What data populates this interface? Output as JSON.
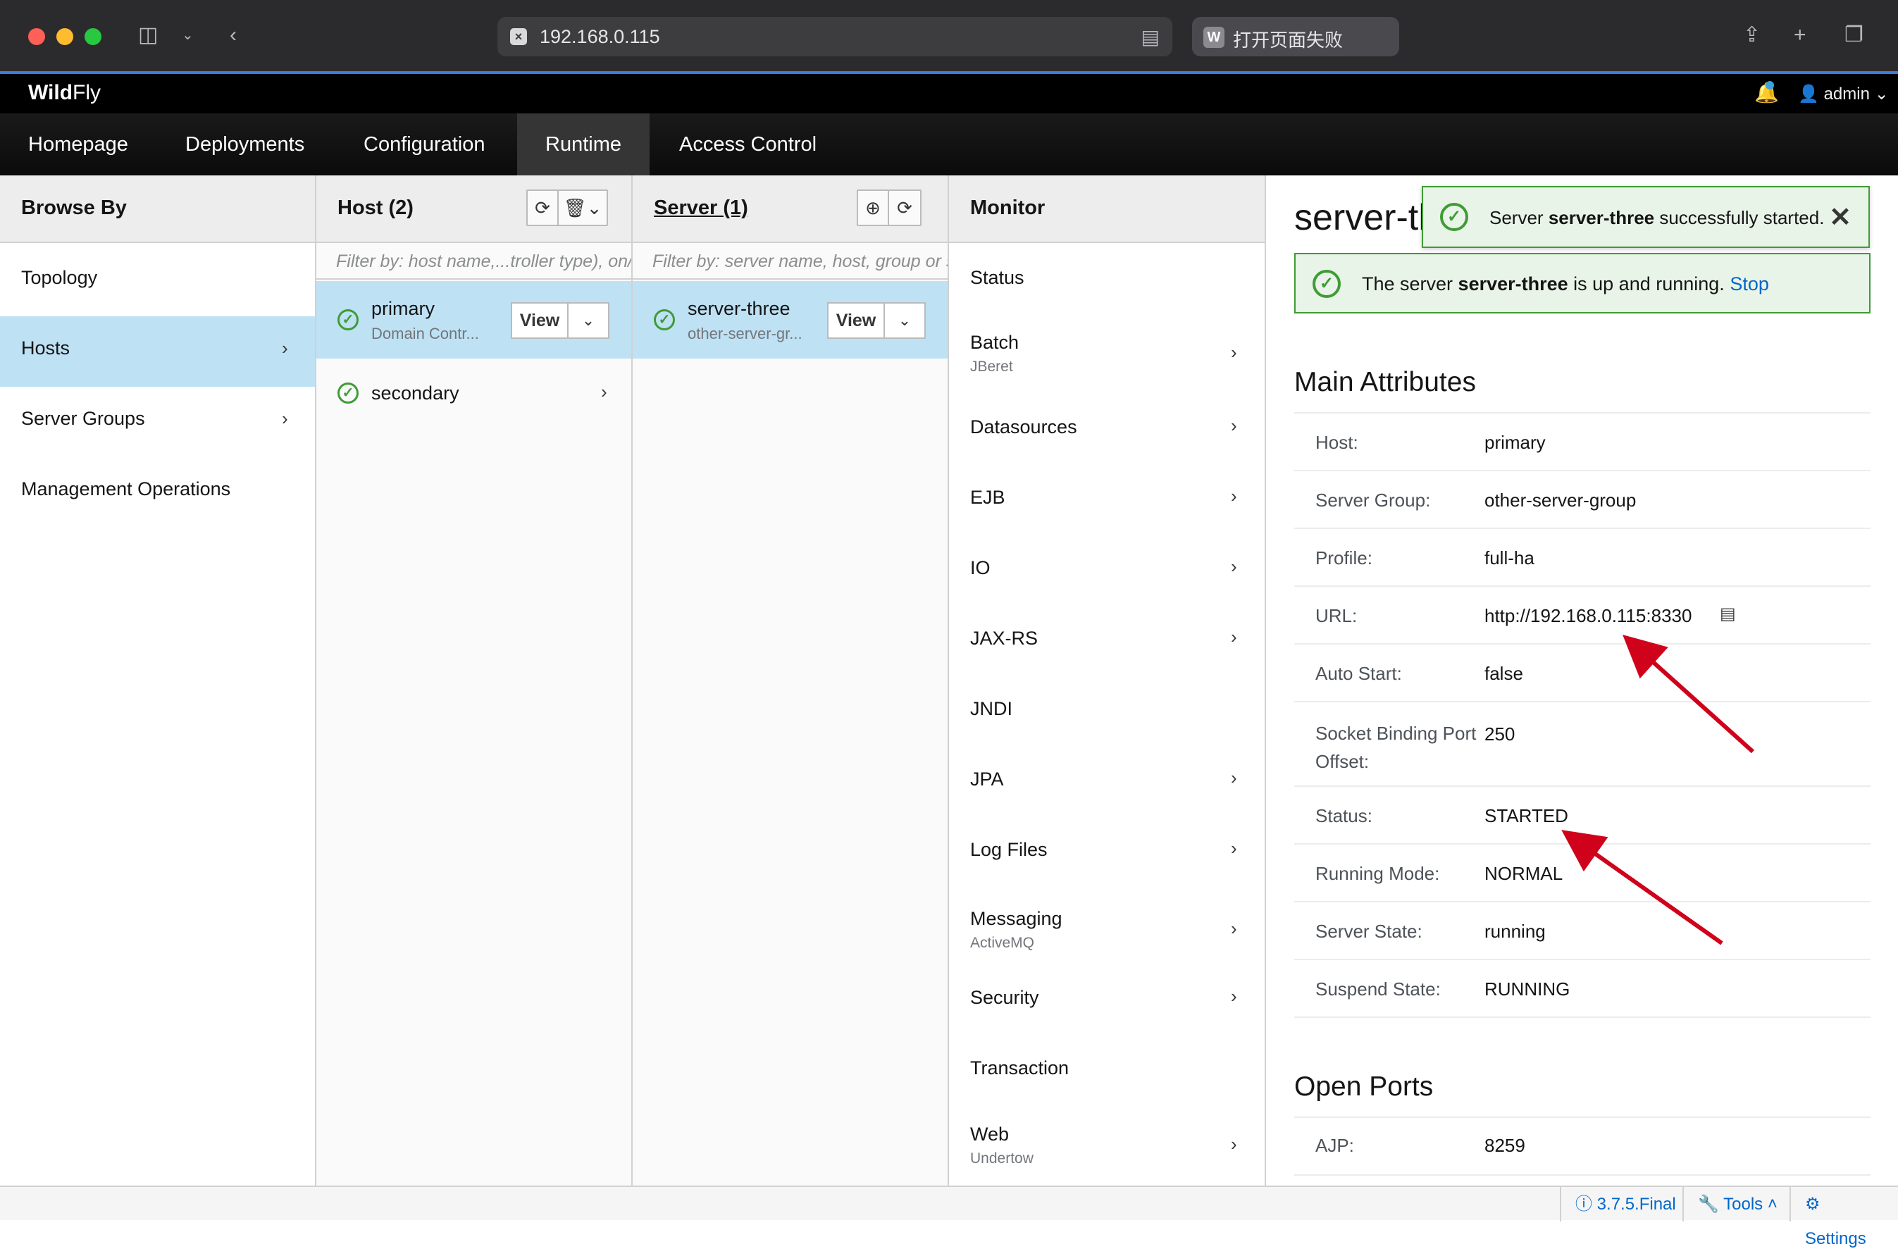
{
  "browser": {
    "url": "192.168.0.115",
    "site_icon": "x-icon",
    "tab_icon_letter": "W",
    "tab_title": "打开页面失败"
  },
  "app": {
    "brand_bold": "Wild",
    "brand_rest": "Fly",
    "user": "admin"
  },
  "nav": {
    "items": [
      "Homepage",
      "Deployments",
      "Configuration",
      "Runtime",
      "Access Control"
    ],
    "active": "Runtime"
  },
  "browse_by": {
    "title": "Browse By",
    "items": [
      "Topology",
      "Hosts",
      "Server Groups",
      "Management Operations"
    ],
    "selected": "Hosts"
  },
  "hosts": {
    "title": "Host (2)",
    "filter_placeholder": "Filter by: host name,...troller type), on/off",
    "items": [
      {
        "name": "primary",
        "subtitle": "Domain Contr...",
        "view_label": "View"
      },
      {
        "name": "secondary"
      }
    ]
  },
  "servers": {
    "title": "Server (1)",
    "filter_placeholder": "Filter by: server name, host, group or status",
    "items": [
      {
        "name": "server-three",
        "subtitle": "other-server-gr...",
        "view_label": "View"
      }
    ]
  },
  "monitor": {
    "title": "Monitor",
    "items": [
      {
        "label": "Status",
        "sub": ""
      },
      {
        "label": "Batch",
        "sub": "JBeret"
      },
      {
        "label": "Datasources",
        "sub": ""
      },
      {
        "label": "EJB",
        "sub": ""
      },
      {
        "label": "IO",
        "sub": ""
      },
      {
        "label": "JAX-RS",
        "sub": ""
      },
      {
        "label": "JNDI",
        "sub": ""
      },
      {
        "label": "JPA",
        "sub": ""
      },
      {
        "label": "Log Files",
        "sub": ""
      },
      {
        "label": "Messaging",
        "sub": "ActiveMQ"
      },
      {
        "label": "Security",
        "sub": ""
      },
      {
        "label": "Transaction",
        "sub": ""
      },
      {
        "label": "Web",
        "sub": "Undertow"
      }
    ]
  },
  "details": {
    "title": "server-three",
    "running_alert": {
      "prefix": "The server ",
      "server": "server-three",
      "suffix": " is up and running. ",
      "action": "Stop"
    },
    "main_attributes_title": "Main Attributes",
    "attributes": [
      {
        "key": "Host:",
        "value": "primary",
        "link": true
      },
      {
        "key": "Server Group:",
        "value": "other-server-group",
        "link": true
      },
      {
        "key": "Profile:",
        "value": "full-ha",
        "link": true
      },
      {
        "key": "URL:",
        "value": "http://192.168.0.115:8330",
        "link": true
      },
      {
        "key": "Auto Start:",
        "value": "false",
        "link": false
      },
      {
        "key": "Socket Binding Port Offset:",
        "value": "250",
        "link": false
      },
      {
        "key": "Status:",
        "value": "STARTED",
        "link": false
      },
      {
        "key": "Running Mode:",
        "value": "NORMAL",
        "link": false
      },
      {
        "key": "Server State:",
        "value": "running",
        "link": false
      },
      {
        "key": "Suspend State:",
        "value": "RUNNING",
        "link": false
      }
    ],
    "open_ports_title": "Open Ports",
    "ports": [
      {
        "key": "AJP:",
        "value": "8259"
      }
    ]
  },
  "toast": {
    "prefix": "Server ",
    "server": "server-three",
    "suffix": " successfully started."
  },
  "footer": {
    "version": "3.7.5.Final",
    "tools": "Tools",
    "settings": "Settings"
  },
  "colors": {
    "selected_row": "#bee1f4",
    "success": "#3f9c35",
    "link": "#0066cc",
    "annotation_arrow": "#d0021b"
  }
}
